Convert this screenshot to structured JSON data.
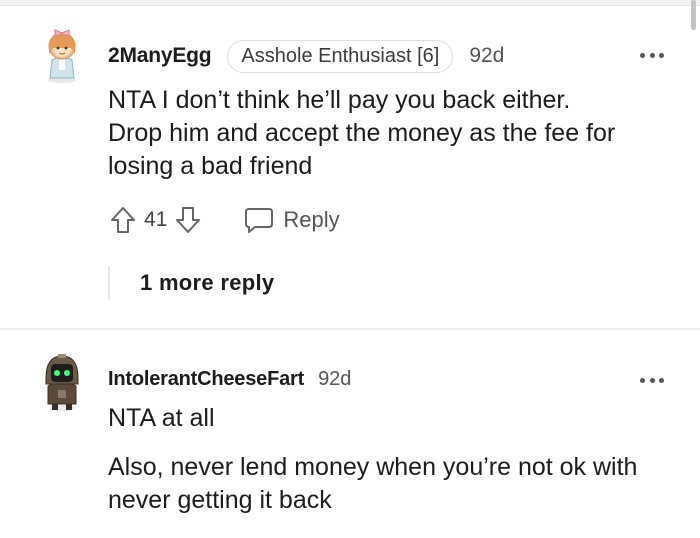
{
  "comments": [
    {
      "username": "2ManyEgg",
      "flair": "Asshole Enthusiast [6]",
      "age": "92d",
      "body": [
        "NTA I don’t think he’ll pay you back either.",
        "Drop him and accept the money as the fee for",
        "losing a bad friend"
      ],
      "score": "41",
      "reply_label": "Reply",
      "more_replies": "1 more reply"
    },
    {
      "username": "IntolerantCheeseFart",
      "age": "92d",
      "body": [
        "NTA at all",
        "Also, never lend money when you’re not ok with never getting it back"
      ]
    }
  ],
  "icons": {
    "upvote": "arrow-up-outline-icon",
    "downvote": "arrow-down-outline-icon",
    "reply": "speech-bubble-icon",
    "more": "three-dots-icon",
    "avatar_1": "girl-with-bow-avatar",
    "avatar_2": "hooded-robot-avatar"
  },
  "colors": {
    "text": "#1c1c1c",
    "muted": "#555555",
    "divider": "#ededed"
  }
}
